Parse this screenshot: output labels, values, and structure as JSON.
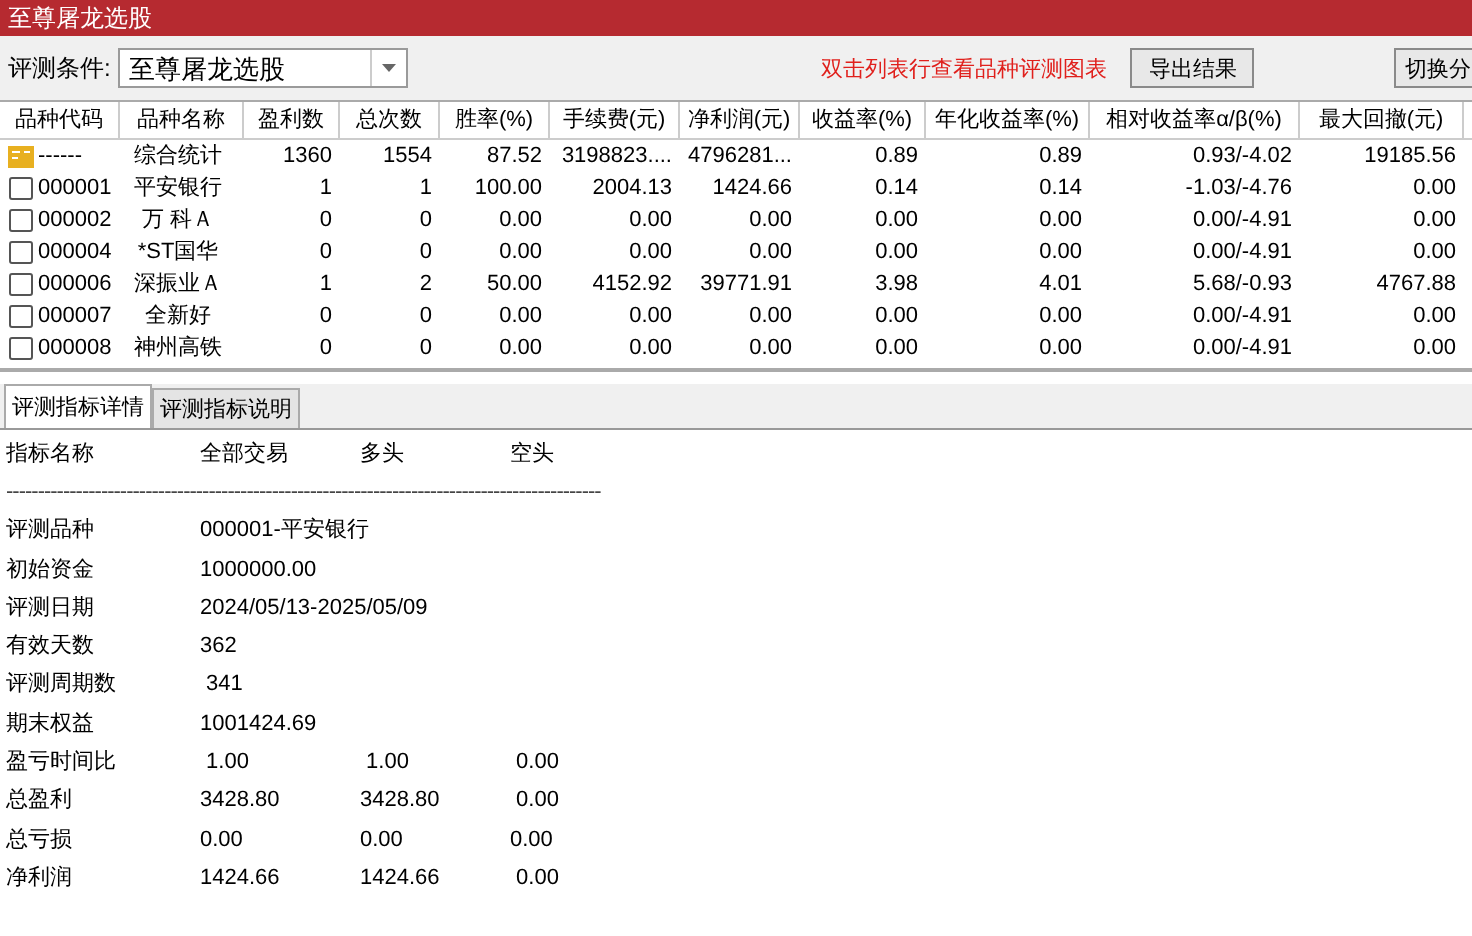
{
  "window": {
    "title": "至尊屠龙选股"
  },
  "toolbar": {
    "condition_label": "评测条件:",
    "condition_value": "至尊屠龙选股",
    "hint": "双击列表行查看品种评测图表",
    "buttons": [
      "导出结果",
      "切换分"
    ]
  },
  "table": {
    "columns": [
      "品种代码",
      "品种名称",
      "盈利数",
      "总次数",
      "胜率(%)",
      "手续费(元)",
      "净利润(元)",
      "收益率(%)",
      "年化收益率(%)",
      "相对收益率α/β(%)",
      "最大回撤(元)"
    ],
    "rows": [
      {
        "kind": "summary",
        "cells": [
          "------",
          "综合统计",
          "1360",
          "1554",
          "87.52",
          "3198823....",
          "4796281...",
          "0.89",
          "0.89",
          "0.93/-4.02",
          "19185.56"
        ]
      },
      {
        "kind": "stock",
        "cells": [
          "000001",
          "平安银行",
          "1",
          "1",
          "100.00",
          "2004.13",
          "1424.66",
          "0.14",
          "0.14",
          "-1.03/-4.76",
          "0.00"
        ]
      },
      {
        "kind": "stock",
        "cells": [
          "000002",
          "万 科Ａ",
          "0",
          "0",
          "0.00",
          "0.00",
          "0.00",
          "0.00",
          "0.00",
          "0.00/-4.91",
          "0.00"
        ]
      },
      {
        "kind": "stock",
        "cells": [
          "000004",
          "*ST国华",
          "0",
          "0",
          "0.00",
          "0.00",
          "0.00",
          "0.00",
          "0.00",
          "0.00/-4.91",
          "0.00"
        ]
      },
      {
        "kind": "stock",
        "cells": [
          "000006",
          "深振业Ａ",
          "1",
          "2",
          "50.00",
          "4152.92",
          "39771.91",
          "3.98",
          "4.01",
          "5.68/-0.93",
          "4767.88"
        ]
      },
      {
        "kind": "stock",
        "cells": [
          "000007",
          "全新好",
          "0",
          "0",
          "0.00",
          "0.00",
          "0.00",
          "0.00",
          "0.00",
          "0.00/-4.91",
          "0.00"
        ]
      },
      {
        "kind": "stock",
        "cells": [
          "000008",
          "神州高铁",
          "0",
          "0",
          "0.00",
          "0.00",
          "0.00",
          "0.00",
          "0.00",
          "0.00/-4.91",
          "0.00"
        ]
      }
    ]
  },
  "tabs": [
    {
      "label": "评测指标详情",
      "selected": true
    },
    {
      "label": "评测指标说明",
      "selected": false
    }
  ],
  "details": {
    "columns": [
      "指标名称",
      "全部交易",
      "多头",
      "空头"
    ],
    "separator": "----------------------------------------------------------------------------------------------",
    "rows": [
      [
        "评测品种",
        "000001-平安银行"
      ],
      [
        "初始资金",
        "1000000.00"
      ],
      [
        "评测日期",
        "2024/05/13-2025/05/09"
      ],
      [
        "有效天数",
        "362"
      ],
      [
        "评测周期数",
        " 341"
      ],
      [
        "期末权益",
        "1001424.69"
      ],
      [
        "盈亏时间比",
        " 1.00",
        " 1.00",
        " 0.00"
      ],
      [
        "总盈利",
        "3428.80",
        "3428.80",
        " 0.00"
      ],
      [
        "总亏损",
        "0.00",
        "0.00",
        "0.00"
      ],
      [
        "净利润",
        "1424.66",
        "1424.66",
        " 0.00"
      ]
    ]
  }
}
